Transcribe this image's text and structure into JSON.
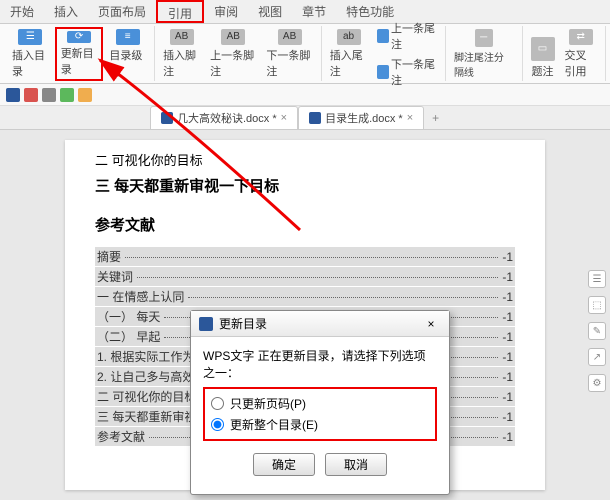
{
  "tabs": {
    "start": "开始",
    "insert": "插入",
    "layout": "页面布局",
    "reference": "引用",
    "review": "审阅",
    "view": "视图",
    "chapter": "章节",
    "special": "特色功能"
  },
  "ribbon": {
    "insert_toc": "插入目录",
    "update_toc": "更新目录",
    "toc_level": "目录级别",
    "insert_footnote": "插入脚注",
    "prev_footnote": "上一条脚注",
    "next_footnote": "下一条脚注",
    "insert_endnote": "插入尾注",
    "prev_endnote": "上一条尾注",
    "next_endnote": "下一条尾注",
    "separator": "脚注尾注分隔线",
    "caption": "题注",
    "crossref": "交叉引用"
  },
  "doctabs": {
    "doc1": "几大高效秘诀.docx *",
    "doc2": "目录生成.docx *"
  },
  "page": {
    "line1": "二 可视化你的目标",
    "heading1": "三 每天都重新审视一下目标",
    "heading2": "参考文献",
    "toc": [
      {
        "text": "摘要",
        "pg": "-1"
      },
      {
        "text": "关键词",
        "pg": "-1"
      },
      {
        "text": "一 在情感上认同",
        "pg": "-1"
      },
      {
        "text": "（一） 每天",
        "pg": "-1"
      },
      {
        "text": "（二） 早起",
        "pg": "-1"
      },
      {
        "text": "1. 根据实际工作为身体补充能量",
        "pg": "-1"
      },
      {
        "text": "2. 让自己多与高效人士在一起",
        "pg": "-1"
      },
      {
        "text": "二 可视化你的目标",
        "pg": "-1"
      },
      {
        "text": "三 每天都重新审视一下目标",
        "pg": "-1"
      },
      {
        "text": "参考文献",
        "pg": "-1"
      }
    ]
  },
  "dialog": {
    "title": "更新目录",
    "prompt": "WPS文字 正在更新目录，请选择下列选项之一：",
    "opt1": "只更新页码(P)",
    "opt2": "更新整个目录(E)",
    "ok": "确定",
    "cancel": "取消"
  },
  "colors": {
    "highlight": "#e00",
    "brand": "#2b579a"
  }
}
